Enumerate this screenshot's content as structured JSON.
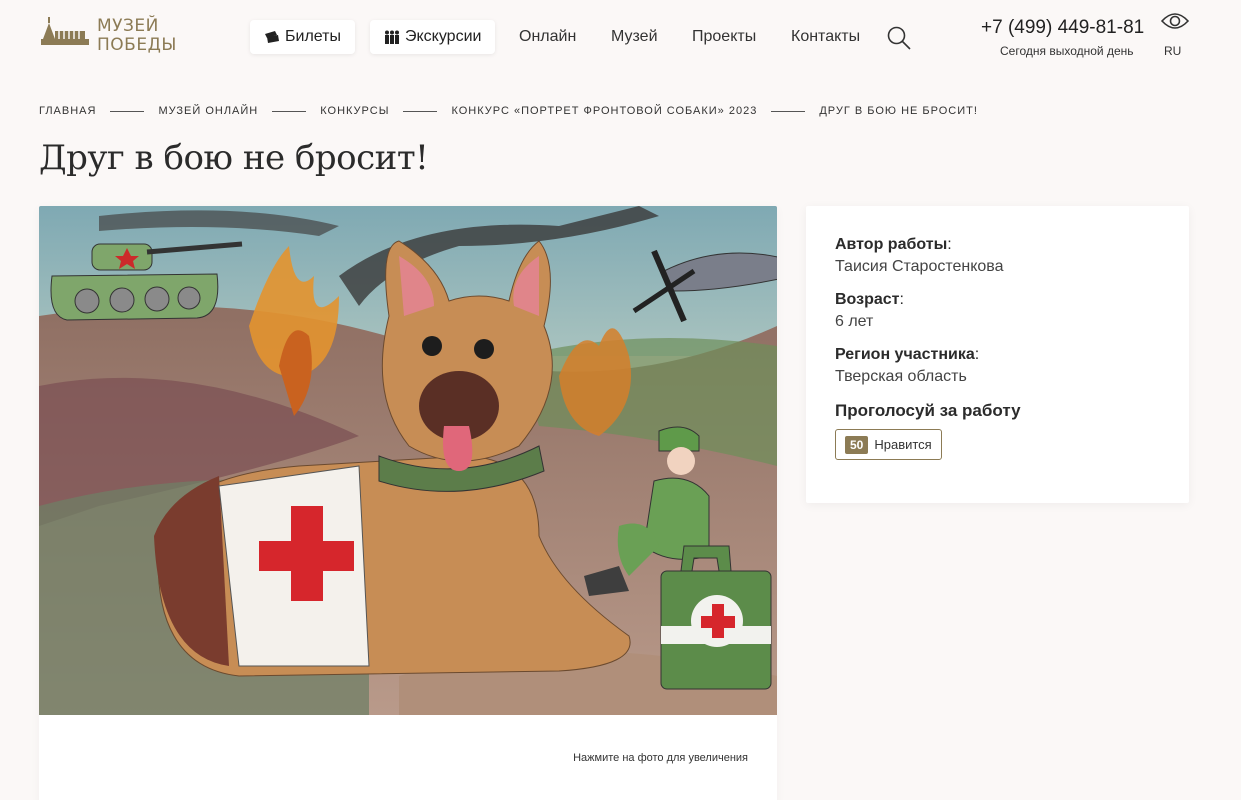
{
  "header": {
    "logo": {
      "line1": "МУЗЕЙ",
      "line2": "ПОБЕДЫ"
    },
    "nav_buttons": [
      {
        "label": "Билеты",
        "icon": "ticket-icon"
      },
      {
        "label": "Экскурсии",
        "icon": "people-icon"
      }
    ],
    "nav_links": [
      "Онлайн",
      "Музей",
      "Проекты",
      "Контакты"
    ],
    "phone": "+7 (499) 449-81-81",
    "schedule_note": "Сегодня выходной день",
    "language": "RU"
  },
  "breadcrumb": [
    "ГЛАВНАЯ",
    "МУЗЕЙ ОНЛАЙН",
    "КОНКУРСЫ",
    "КОНКУРС «ПОРТРЕТ ФРОНТОВОЙ СОБАКИ» 2023",
    "ДРУГ В БОЮ НЕ БРОСИТ!"
  ],
  "page_title": "Друг в бою не бросит!",
  "image": {
    "hint": "Нажмите на фото для увеличения"
  },
  "info": {
    "author_label": "Автор работы",
    "author_value": "Таисия Старостенкова",
    "age_label": "Возраст",
    "age_value": "6 лет",
    "region_label": "Регион участника",
    "region_value": "Тверская область",
    "vote_title": "Проголосуй за работу",
    "like_count": "50",
    "like_label": "Нравится"
  },
  "colors": {
    "accent": "#8c7b55",
    "background": "#fbf8f7"
  }
}
